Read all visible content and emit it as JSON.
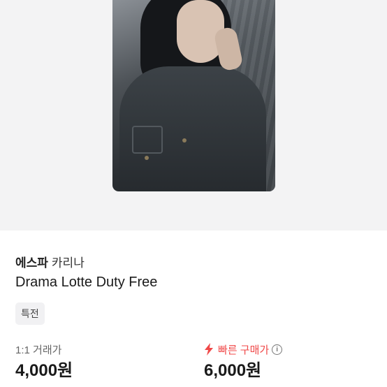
{
  "product": {
    "group": "에스파",
    "member": "카리나",
    "title": "Drama Lotte Duty Free",
    "tag": "특전"
  },
  "pricing": {
    "trade_label": "1:1 거래가",
    "trade_price": "4,000원",
    "fast_label": "빠른 구매가",
    "fast_price": "6,000원",
    "fast_color": "#f04848"
  },
  "icons": {
    "fast": "lightning-bolt-icon",
    "info": "info-circle-icon"
  }
}
